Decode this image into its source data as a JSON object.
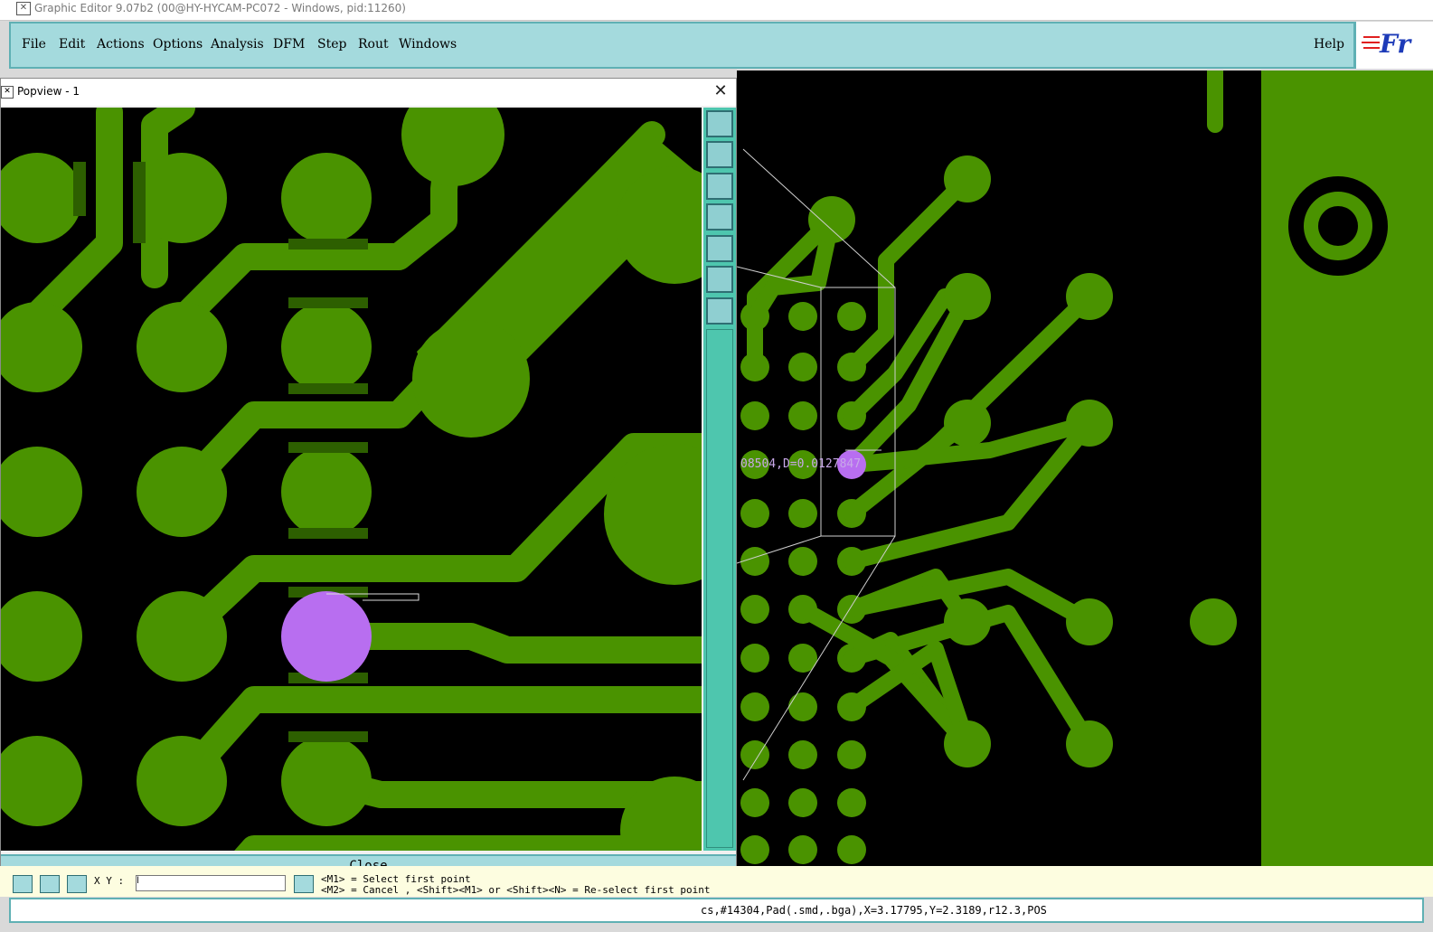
{
  "window": {
    "title": "Graphic Editor 9.07b2 (00@HY-HYCAM-PC072 - Windows, pid:11260)",
    "app_icon": "editor-icon"
  },
  "menu": {
    "file": "File",
    "edit": "Edit",
    "actions": "Actions",
    "options": "Options",
    "analysis": "Analysis",
    "dfm": "DFM",
    "step": "Step",
    "rout": "Rout",
    "windows": "Windows",
    "help": "Help"
  },
  "logo": {
    "text": "Fr"
  },
  "popview": {
    "title": "Popview - 1",
    "close_button": "Close",
    "tools": [
      "zoom-home-icon",
      "pan-up-icon",
      "pan-down-icon",
      "pan-left-icon",
      "pan-right-icon",
      "zoom-fit-icon",
      "zoom-center-icon"
    ]
  },
  "main": {
    "measure_label": "08504,D=0.0127847"
  },
  "bottom": {
    "xy_label": "X Y :",
    "xy_value": "l",
    "prompt_line1": "<M1> = Select first point",
    "prompt_line2": "<M2> = Cancel , <Shift><M1> or <Shift><N> = Re-select first point"
  },
  "status": {
    "text": "cs,#14304,Pad(.smd,.bga),X=3.17795,Y=2.3189,r12.3,POS"
  },
  "colors": {
    "copper": "#4a9300",
    "highlight": "#b86ef0",
    "board_bg": "#000000",
    "menu_bg": "#a4dadd"
  }
}
